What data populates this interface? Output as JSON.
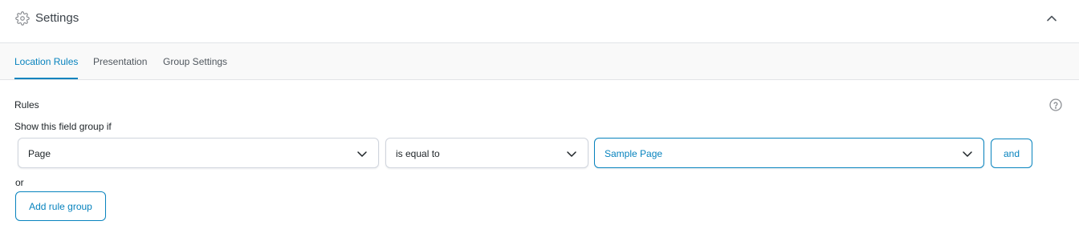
{
  "header": {
    "title": "Settings",
    "icon": "gear-icon",
    "collapse_icon": "chevron-up-icon"
  },
  "tabs": [
    {
      "label": "Location Rules",
      "active": true
    },
    {
      "label": "Presentation",
      "active": false
    },
    {
      "label": "Group Settings",
      "active": false
    }
  ],
  "rules": {
    "heading": "Rules",
    "help_icon": "help-circle-icon",
    "condition_label": "Show this field group if",
    "rule": {
      "param": "Page",
      "operator": "is equal to",
      "value": "Sample Page"
    },
    "and_label": "and",
    "or_label": "or",
    "add_group_label": "Add rule group"
  },
  "colors": {
    "accent": "#0783be",
    "border": "#d0d5dd",
    "tabs_background": "#f9f9f9",
    "text": "#1d2327"
  }
}
